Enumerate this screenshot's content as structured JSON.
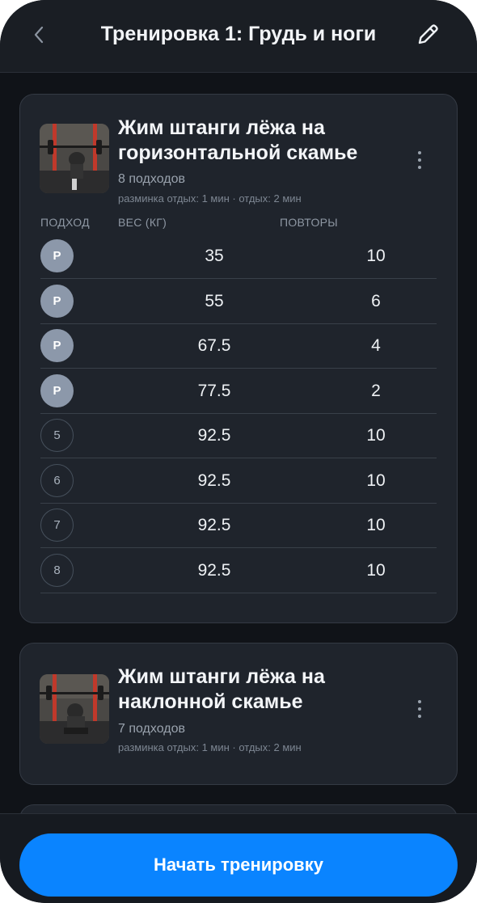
{
  "header": {
    "title": "Тренировка 1: Грудь и ноги",
    "back_icon": "chevron-left-icon",
    "edit_icon": "pencil-icon"
  },
  "exercises": [
    {
      "name_line1": "Жим штанги лёжа на",
      "name_line2": "горизонтальной скамье",
      "sets_label": "8 подходов",
      "rest_label": "разминка отдых: 1 мин · отдых: 2 мин",
      "columns": {
        "set": "ПОДХОД",
        "weight": "ВЕС (КГ)",
        "reps": "ПОВТОРЫ"
      },
      "sets": [
        {
          "set": "Р",
          "weight": "35",
          "reps": "10"
        },
        {
          "set": "Р",
          "weight": "55",
          "reps": "6"
        },
        {
          "set": "Р",
          "weight": "67.5",
          "reps": "4"
        },
        {
          "set": "Р",
          "weight": "77.5",
          "reps": "2"
        },
        {
          "set": "5",
          "weight": "92.5",
          "reps": "10"
        },
        {
          "set": "6",
          "weight": "92.5",
          "reps": "10"
        },
        {
          "set": "7",
          "weight": "92.5",
          "reps": "10"
        },
        {
          "set": "8",
          "weight": "92.5",
          "reps": "10"
        }
      ]
    },
    {
      "name_line1": "Жим штанги лёжа на",
      "name_line2": "наклонной скамье",
      "sets_label": "7 подходов",
      "rest_label": "разминка отдых: 1 мин · отдых: 2 мин"
    }
  ],
  "footer": {
    "start_label": "Начать тренировку"
  },
  "colors": {
    "accent": "#0a84ff",
    "background": "#101318",
    "card": "#1f242c",
    "warmup_badge": "#8c98aa"
  }
}
